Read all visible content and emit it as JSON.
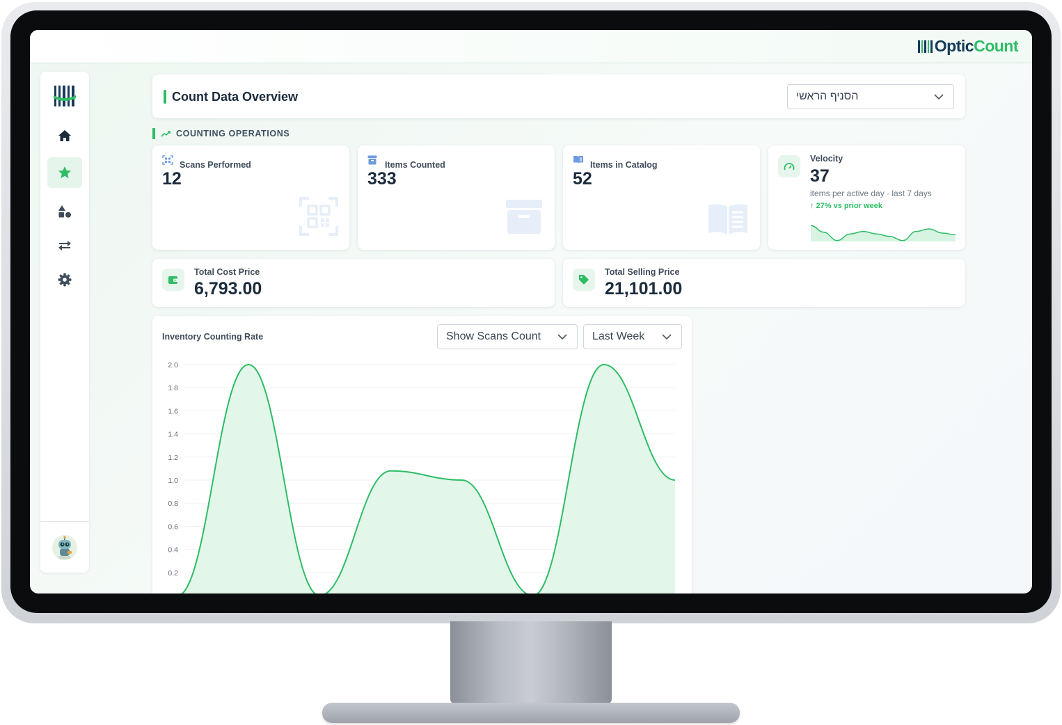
{
  "brand": {
    "name_part1": "Optic",
    "name_part2": "Count",
    "accent_color": "#2ebd65",
    "primary_color": "#163a5a"
  },
  "sidebar": {
    "items": [
      {
        "name": "home",
        "icon": "home-icon",
        "active": false
      },
      {
        "name": "favorites",
        "icon": "star-icon",
        "active": true
      },
      {
        "name": "categories",
        "icon": "shapes-icon",
        "active": false
      },
      {
        "name": "transfers",
        "icon": "swap-arrows-icon",
        "active": false
      },
      {
        "name": "settings",
        "icon": "gear-icon",
        "active": false
      }
    ],
    "avatar_icon": "robot-avatar-icon"
  },
  "header": {
    "title": "Count Data Overview",
    "branch_select": "הסניף הראשי"
  },
  "section": {
    "title": "COUNTING OPERATIONS",
    "icon": "trend-up-icon"
  },
  "stats": [
    {
      "label": "Scans Performed",
      "value": "12",
      "icon": "qr-scan-icon"
    },
    {
      "label": "Items Counted",
      "value": "333",
      "icon": "archive-box-icon"
    },
    {
      "label": "Items in Catalog",
      "value": "52",
      "icon": "open-book-icon"
    }
  ],
  "velocity": {
    "label": "Velocity",
    "value": "37",
    "subtitle": "items per active day · last 7 days",
    "trend": "↑ 27% vs prior week",
    "icon": "gauge-icon",
    "sparkline": [
      0.95,
      0.55,
      0.05,
      0.45,
      0.6,
      0.45,
      0.3,
      0.05,
      0.6,
      0.75,
      0.5,
      0.4
    ]
  },
  "prices": {
    "cost": {
      "label": "Total Cost Price",
      "value": "6,793.00",
      "icon": "wallet-icon"
    },
    "selling": {
      "label": "Total Selling Price",
      "value": "21,101.00",
      "icon": "price-tag-icon"
    }
  },
  "chart": {
    "title": "Inventory Counting Rate",
    "metric_select": "Show Scans Count",
    "period_select": "Last Week"
  },
  "chart_data": {
    "type": "area",
    "title": "Inventory Counting Rate",
    "ylim": [
      0,
      2.0
    ],
    "yticks": [
      "0.2",
      "0.4",
      "0.6",
      "0.8",
      "1.0",
      "1.2",
      "1.4",
      "1.6",
      "1.8",
      "2.0"
    ],
    "grid": true,
    "series": [
      {
        "values": [
          0,
          2,
          0,
          1.08,
          1,
          0,
          2,
          1
        ]
      }
    ]
  }
}
